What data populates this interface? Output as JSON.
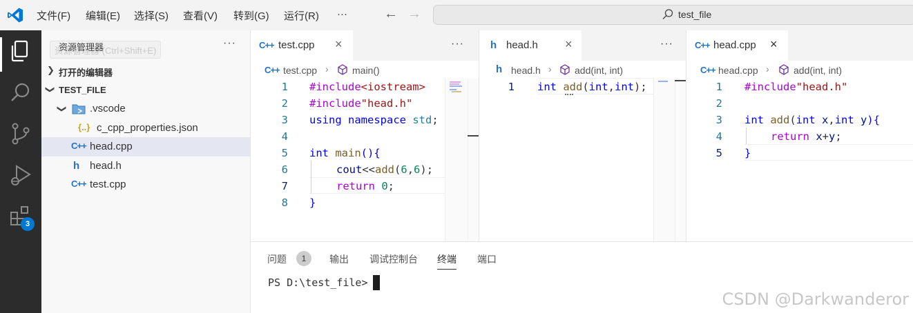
{
  "menu": {
    "items": [
      "文件(F)",
      "编辑(E)",
      "选择(S)",
      "查看(V)",
      "转到(G)",
      "运行(R)"
    ],
    "more": "···"
  },
  "command_center": {
    "text": "test_file"
  },
  "activity": {
    "extensions_badge": "3"
  },
  "sidebar": {
    "title": "资源管理器",
    "tooltip_prefix": "资",
    "tooltip": "资源管理器 (Ctrl+Shift+E)",
    "more": "···",
    "open_editors": "打开的编辑器",
    "folder": "TEST_FILE",
    "items": [
      {
        "label": ".vscode",
        "icon": "folder-vscode-icon"
      },
      {
        "label": "c_cpp_properties.json",
        "icon": "json-icon",
        "icon_text": "{..}"
      },
      {
        "label": "head.cpp",
        "icon": "cpp-file-icon",
        "icon_text": "C++"
      },
      {
        "label": "head.h",
        "icon": "h-file-icon",
        "icon_text": "h"
      },
      {
        "label": "test.cpp",
        "icon": "cpp-file-icon",
        "icon_text": "C++"
      }
    ]
  },
  "editor1": {
    "tab": "test.cpp",
    "tab_icon": "C++",
    "close": "×",
    "more": "···",
    "crumb_file": "test.cpp",
    "crumb_symbol": "main()",
    "line_numbers": [
      "1",
      "2",
      "3",
      "4",
      "5",
      "6",
      "7",
      "8"
    ],
    "code": {
      "l1a": "#include",
      "l1b": "<iostream>",
      "l2a": "#include",
      "l2b": "\"head.h\"",
      "l3a": "using",
      "l3b": " namespace",
      "l3c": " std",
      "l3d": ";",
      "l5a": "int",
      "l5b": " main",
      "l5c": "(){",
      "l6a": "cout",
      "l6b": "<<",
      "l6c": "add",
      "l6d": "(",
      "l6e": "6",
      "l6f": ",",
      "l6g": "6",
      "l6h": ");",
      "l7a": "return",
      "l7b": " 0",
      "l7c": ";",
      "l8a": "}"
    }
  },
  "editor2": {
    "tab": "head.h",
    "tab_icon": "h",
    "close": "×",
    "more": "···",
    "crumb_file": "head.h",
    "crumb_symbol": "add(int, int)",
    "line_numbers": [
      "1"
    ],
    "code": {
      "a": "int",
      "b": " add",
      "c": "(",
      "d": "int",
      "e": ",",
      "f": "int",
      "g": ");"
    }
  },
  "editor3": {
    "tab": "head.cpp",
    "tab_icon": "C++",
    "close": "×",
    "crumb_file": "head.cpp",
    "crumb_symbol": "add(int, int)",
    "line_numbers": [
      "1",
      "2",
      "3",
      "4",
      "5"
    ],
    "code": {
      "l1a": "#include",
      "l1b": "\"head.h\"",
      "l3a": "int",
      "l3b": " add",
      "l3c": "(",
      "l3d": "int",
      "l3e": " x",
      "l3f": ",",
      "l3g": "int",
      "l3h": " y",
      "l3i": "){",
      "l4a": "return",
      "l4b": " x",
      "l4c": "+",
      "l4d": "y",
      "l4e": ";",
      "l5a": "}"
    }
  },
  "panel": {
    "tabs": [
      "问题",
      "输出",
      "调试控制台",
      "终端",
      "端口"
    ],
    "problems_count": "1",
    "terminal_prompt": "PS D:\\test_file> "
  },
  "watermark": "CSDN @Darkwanderor",
  "colors": {
    "activity_bar": "#2c2c2c",
    "accent": "#0078d4",
    "keyword": "#0000ff",
    "preprocessor": "#af00db",
    "string": "#a31515",
    "function": "#795e26",
    "number": "#098658"
  }
}
